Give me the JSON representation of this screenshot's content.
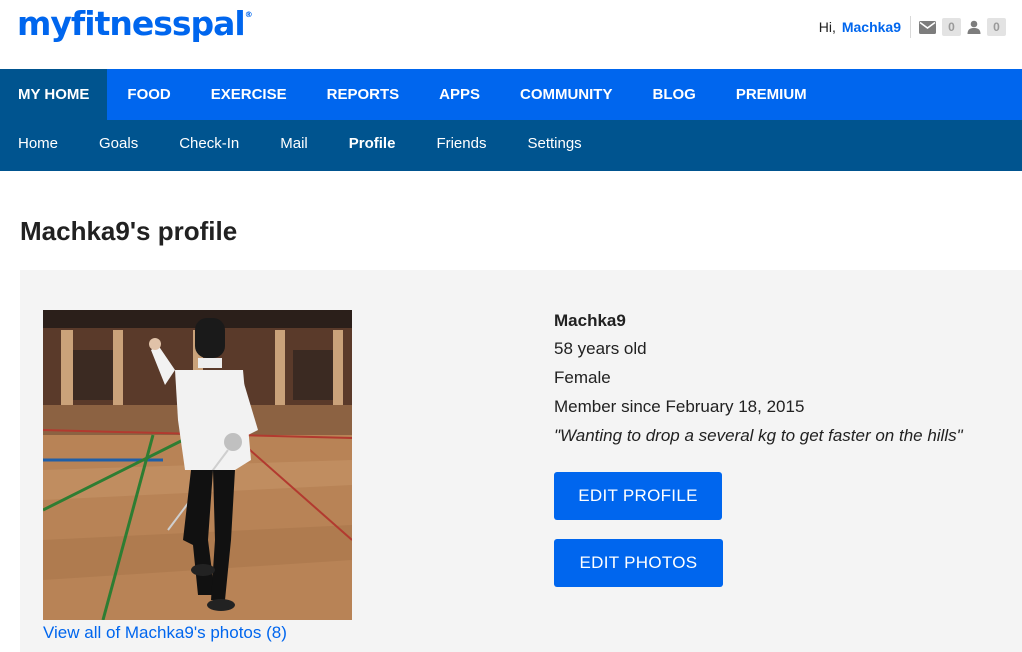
{
  "header": {
    "logo": "myfitnesspal",
    "logo_mark": "®",
    "greeting": "Hi,",
    "username": "Machka9",
    "mail_count": "0",
    "friend_requests_count": "0",
    "mail_icon": "envelope-icon",
    "friends_icon": "person-icon"
  },
  "primary_nav": [
    {
      "label": "MY HOME",
      "active": true
    },
    {
      "label": "FOOD"
    },
    {
      "label": "EXERCISE"
    },
    {
      "label": "REPORTS"
    },
    {
      "label": "APPS"
    },
    {
      "label": "COMMUNITY"
    },
    {
      "label": "BLOG"
    },
    {
      "label": "PREMIUM"
    }
  ],
  "secondary_nav": [
    {
      "label": "Home"
    },
    {
      "label": "Goals"
    },
    {
      "label": "Check-In"
    },
    {
      "label": "Mail"
    },
    {
      "label": "Profile",
      "active": true
    },
    {
      "label": "Friends"
    },
    {
      "label": "Settings"
    }
  ],
  "page": {
    "title": "Machka9's profile"
  },
  "profile": {
    "name": "Machka9",
    "age": "58 years old",
    "gender": "Female",
    "member_since": "Member since February 18, 2015",
    "quote": "\"Wanting to drop a several kg to get faster on the hills\"",
    "edit_profile_label": "EDIT PROFILE",
    "edit_photos_label": "EDIT PHOTOS",
    "photos_link": "View all of Machka9's photos (8)"
  },
  "colors": {
    "brand_blue": "#0066ee",
    "nav_dark": "#00548f",
    "panel_bg": "#f4f4f4"
  }
}
